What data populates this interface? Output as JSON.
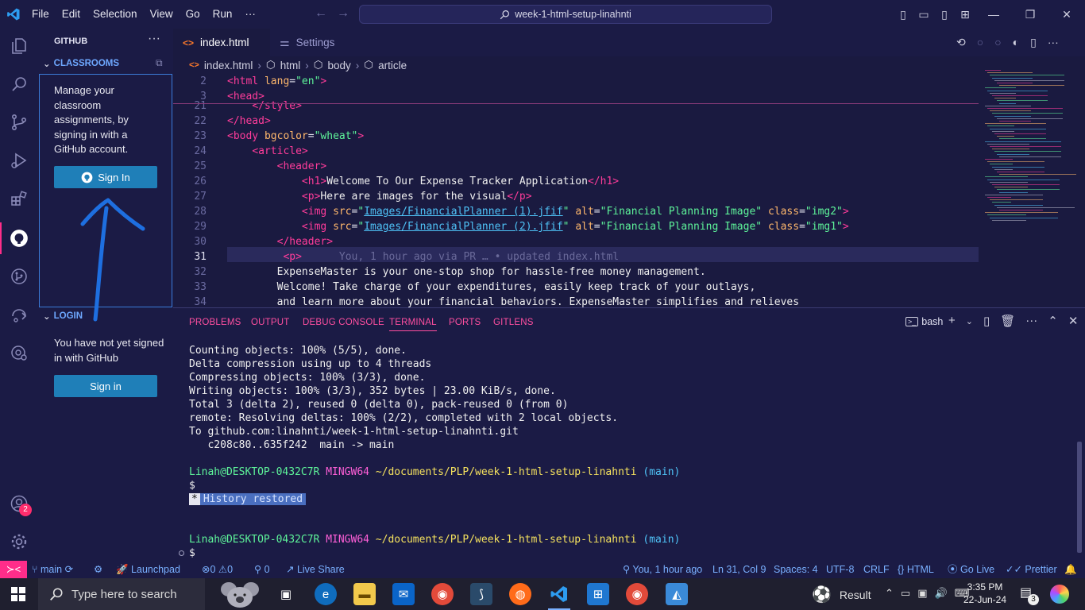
{
  "titlebar": {
    "menu": [
      "File",
      "Edit",
      "Selection",
      "View",
      "Go",
      "Run",
      "···"
    ],
    "search_text": "week-1-html-setup-linahnti"
  },
  "sidebar": {
    "title": "GITHUB",
    "more": "···",
    "classrooms_header": "CLASSROOMS",
    "classrooms_text": "Manage your classroom assignments, by signing in with a GitHub account.",
    "sign_in_github_label": "Sign In",
    "login_header": "LOGIN",
    "login_text": "You have not yet signed in with GitHub",
    "sign_in_label": "Sign in"
  },
  "activity_badge": "2",
  "tabs": [
    {
      "label": "index.html",
      "close": "×"
    },
    {
      "label": "Settings"
    }
  ],
  "breadcrumb": [
    "index.html",
    "html",
    "body",
    "article"
  ],
  "editor": {
    "lines": [
      {
        "n": "2",
        "html": "<span class='kw'>&lt;html</span> <span class='at'>lang</span>=<span class='st'>\"en\"</span><span class='kw'>&gt;</span>"
      },
      {
        "n": "3",
        "html": "<span class='kw'>&lt;head&gt;</span>"
      },
      {
        "n": "21",
        "html": "    <span class='kw'>&lt;/style&gt;</span>"
      },
      {
        "n": "22",
        "html": "<span class='kw'>&lt;/head&gt;</span>"
      },
      {
        "n": "23",
        "html": "<span class='kw'>&lt;body</span> <span class='at'>bgcolor</span>=<span class='st'>\"wheat\"</span><span class='kw'>&gt;</span>"
      },
      {
        "n": "24",
        "html": "    <span class='kw'>&lt;article&gt;</span>"
      },
      {
        "n": "25",
        "html": "        <span class='kw'>&lt;header&gt;</span>"
      },
      {
        "n": "26",
        "html": "            <span class='kw'>&lt;h1&gt;</span><span class='tx'>Welcome To Our Expense Tracker Application</span><span class='kw'>&lt;/h1&gt;</span>"
      },
      {
        "n": "27",
        "html": "            <span class='kw'>&lt;p&gt;</span><span class='tx'>Here are images for the visual</span><span class='kw'>&lt;/p&gt;</span>"
      },
      {
        "n": "28",
        "html": "            <span class='kw'>&lt;img</span> <span class='at'>src</span>=<span class='st'>\"</span><span class='lk'>Images/FinancialPlanner (1).jfif</span><span class='st'>\"</span> <span class='at'>alt</span>=<span class='st'>\"Financial Planning Image\"</span> <span class='at'>class</span>=<span class='st'>\"img2\"</span><span class='kw'>&gt;</span>"
      },
      {
        "n": "29",
        "html": "            <span class='kw'>&lt;img</span> <span class='at'>src</span>=<span class='st'>\"</span><span class='lk'>Images/FinancialPlanner (2).jfif</span><span class='st'>\"</span> <span class='at'>alt</span>=<span class='st'>\"Financial Planning Image\"</span> <span class='at'>class</span>=<span class='st'>\"img1\"</span><span class='kw'>&gt;</span>"
      },
      {
        "n": "30",
        "html": "        <span class='kw'>&lt;/header&gt;</span>"
      },
      {
        "n": "31",
        "html": "         <span class='kw'>&lt;p&gt;</span>      <span class='ghost'>You, 1 hour ago via PR … • updated index.html</span>"
      },
      {
        "n": "32",
        "html": "        <span class='tx'>ExpenseMaster is your one-stop shop for hassle-free money management.</span>"
      },
      {
        "n": "33",
        "html": "        <span class='tx'>Welcome! Take charge of your expenditures, easily keep track of your outlays,</span>"
      },
      {
        "n": "34",
        "html": "        <span class='tx'>and learn more about your financial behaviors. ExpenseMaster simplifies and relieves</span>"
      }
    ]
  },
  "panel": {
    "tabs": [
      "PROBLEMS",
      "OUTPUT",
      "DEBUG CONSOLE",
      "TERMINAL",
      "PORTS",
      "GITLENS"
    ],
    "active_tab": "TERMINAL",
    "shell": "bash",
    "terminal": [
      "Counting objects: 100% (5/5), done.",
      "Delta compression using up to 4 threads",
      "Compressing objects: 100% (3/3), done.",
      "Writing objects: 100% (3/3), 352 bytes | 23.00 KiB/s, done.",
      "Total 3 (delta 2), reused 0 (delta 0), pack-reused 0 (from 0)",
      "remote: Resolving deltas: 100% (2/2), completed with 2 local objects.",
      "To github.com:linahnti/week-1-html-setup-linahnti.git",
      "   c208c80..635f242  main -> main"
    ],
    "prompt_user": "Linah@DESKTOP-0432C7R",
    "prompt_shell": "MINGW64",
    "prompt_path": "~/documents/PLP/week-1-html-setup-linahnti",
    "prompt_branch": "(main)",
    "dollar": "$",
    "history_star": "*",
    "history_text": "History restored"
  },
  "statusbar": {
    "branch": "main",
    "launchpad": "Launchpad",
    "errors": "0",
    "warnings": "0",
    "ports": "0",
    "liveshare": "Live Share",
    "blame": "You, 1 hour ago",
    "position": "Ln 31, Col 9",
    "spaces": "Spaces: 4",
    "encoding": "UTF-8",
    "eol": "CRLF",
    "language": "HTML",
    "golive": "Go Live",
    "prettier": "Prettier"
  },
  "taskbar": {
    "search_placeholder": "Type here to search",
    "weather": "Result",
    "time": "3:35 PM",
    "date": "22-Jun-24",
    "notif_count": "3"
  },
  "colors": {
    "bg": "#1a1a40",
    "accent_pink": "#ff2d8a",
    "accent_blue": "#1f7fb8"
  }
}
